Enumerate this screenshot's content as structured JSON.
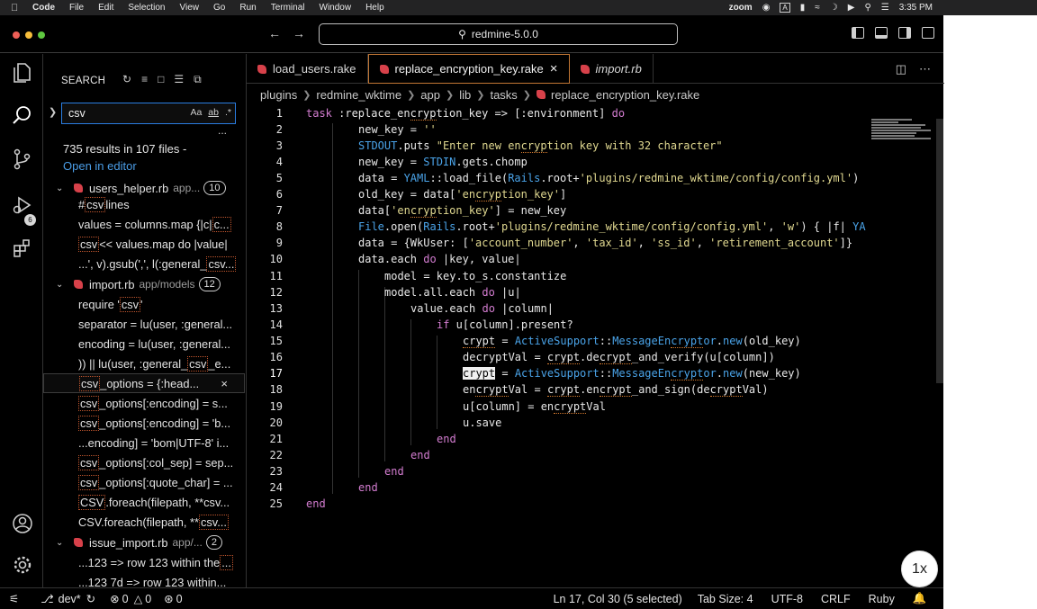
{
  "menubar": {
    "app": "Code",
    "items": [
      "File",
      "Edit",
      "Selection",
      "View",
      "Go",
      "Run",
      "Terminal",
      "Window",
      "Help"
    ],
    "right": {
      "zoom": "zoom",
      "time": "3:35 PM"
    }
  },
  "titlebar": {
    "search": "redmine-5.0.0"
  },
  "activity": {
    "scm_badge": "6"
  },
  "sidebar": {
    "title": "SEARCH",
    "query": "csv",
    "opt_case": "Aa",
    "opt_word": "ab",
    "opt_regex": ".*",
    "more": "...",
    "summary": "735 results in 107 files -",
    "open_in_editor": "Open in editor",
    "files": [
      {
        "name": "users_helper.rb",
        "path": "app...",
        "count": "10"
      },
      {
        "name": "import.rb",
        "path": "app/models",
        "count": "12"
      },
      {
        "name": "issue_import.rb",
        "path": "app/...",
        "count": "2"
      }
    ],
    "m1": [
      "# ",
      "csv",
      " lines"
    ],
    "m2": [
      "values = columns.map {|c| ",
      "c..."
    ],
    "m3": [
      "csv",
      " << values.map do |value|"
    ],
    "m4": [
      "...', v).gsub(',', l(:general_",
      "csv..."
    ],
    "m5": [
      "require '",
      "csv",
      "'"
    ],
    "m6": [
      "separator = lu(user, :general...",
      ""
    ],
    "m7": [
      "encoding = lu(user, :general...",
      ""
    ],
    "m8": [
      ")) || lu(user, :general_",
      "csv",
      "_e..."
    ],
    "m9": [
      "csv",
      "_options = {:head..."
    ],
    "m10": [
      "csv",
      "_options[:encoding] = s..."
    ],
    "m11": [
      "csv",
      "_options[:encoding] = 'b..."
    ],
    "m12": [
      "...encoding] = 'bom|UTF-8' i..."
    ],
    "m13": [
      "csv",
      "_options[:col_sep] = sep..."
    ],
    "m14": [
      "csv",
      "_options[:quote_char] = ..."
    ],
    "m15": [
      "CSV",
      ".foreach(filepath, **csv..."
    ],
    "m16": [
      "CSV.foreach(filepath, **",
      "csv..."
    ],
    "m17": [
      "...123  => row 123 within the ",
      "..."
    ],
    "m18": [
      "...123 7d    => row 123 within..."
    ],
    "close": "×"
  },
  "tabs": [
    {
      "label": "load_users.rake"
    },
    {
      "label": "replace_encryption_key.rake",
      "close": "×"
    },
    {
      "label": "import.rb"
    }
  ],
  "breadcrumb": [
    "plugins",
    "redmine_wktime",
    "app",
    "lib",
    "tasks",
    "replace_encryption_key.rake"
  ],
  "code": {
    "lines": [
      "1",
      "2",
      "3",
      "4",
      "5",
      "6",
      "7",
      "8",
      "9",
      "10",
      "11",
      "12",
      "13",
      "14",
      "15",
      "16",
      "17",
      "18",
      "19",
      "20",
      "21",
      "22",
      "23",
      "24",
      "25"
    ]
  },
  "status": {
    "branch": "dev*",
    "errors": "0",
    "warnings": "0",
    "ports": "0",
    "position": "Ln 17, Col 30 (5 selected)",
    "tabsize": "Tab Size: 4",
    "encoding": "UTF-8",
    "eol": "CRLF",
    "language": "Ruby"
  },
  "zoom_badge": "1x"
}
